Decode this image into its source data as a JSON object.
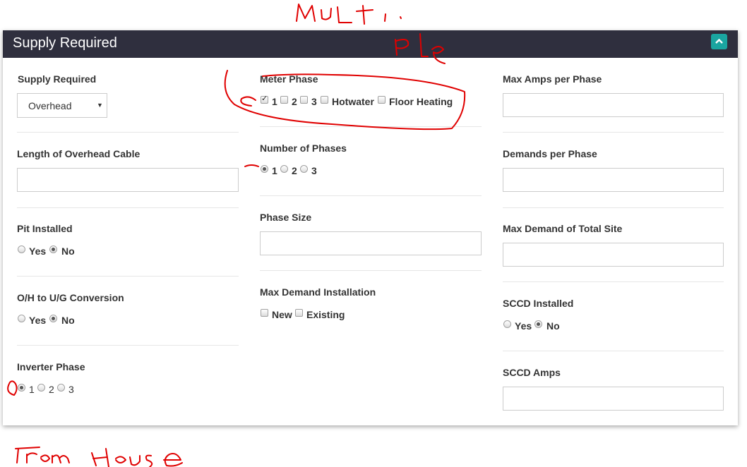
{
  "panel": {
    "title": "Supply Required"
  },
  "left": {
    "supply_required": {
      "label": "Supply Required",
      "selected": "Overhead"
    },
    "length_overhead": {
      "label": "Length of Overhead Cable",
      "value": ""
    },
    "pit_installed": {
      "label": "Pit Installed",
      "options": [
        "Yes",
        "No"
      ],
      "selected": "No"
    },
    "oh_ug": {
      "label": "O/H to U/G Conversion",
      "options": [
        "Yes",
        "No"
      ],
      "selected": "No"
    },
    "inverter_phase": {
      "label": "Inverter Phase",
      "options": [
        "1",
        "2",
        "3"
      ],
      "selected": "1"
    }
  },
  "middle": {
    "meter_phase": {
      "label": "Meter Phase",
      "options": [
        "1",
        "2",
        "3",
        "Hotwater",
        "Floor Heating"
      ],
      "checked": [
        "1"
      ]
    },
    "number_of_phases": {
      "label": "Number of Phases",
      "options": [
        "1",
        "2",
        "3"
      ],
      "selected": "1"
    },
    "phase_size": {
      "label": "Phase Size",
      "value": ""
    },
    "max_demand_installation": {
      "label": "Max Demand Installation",
      "options": [
        "New",
        "Existing"
      ],
      "checked": []
    }
  },
  "right": {
    "max_amps": {
      "label": "Max Amps per Phase",
      "value": ""
    },
    "demands_per_phase": {
      "label": "Demands per Phase",
      "value": ""
    },
    "max_demand_total": {
      "label": "Max Demand of Total Site",
      "value": ""
    },
    "sccd_installed": {
      "label": "SCCD Installed",
      "options": [
        "Yes",
        "No"
      ],
      "selected": "No"
    },
    "sccd_amps": {
      "label": "SCCD Amps",
      "value": ""
    }
  },
  "annotations": {
    "top_note": "Multiple",
    "bottom_note": "From House",
    "ink_color": "#e00000"
  },
  "icons": {
    "collapse": "chevron-up-icon",
    "dropdown": "triangle-down-icon"
  },
  "colors": {
    "header_bg": "#2f2f3e",
    "accent": "#1aa5a0"
  }
}
